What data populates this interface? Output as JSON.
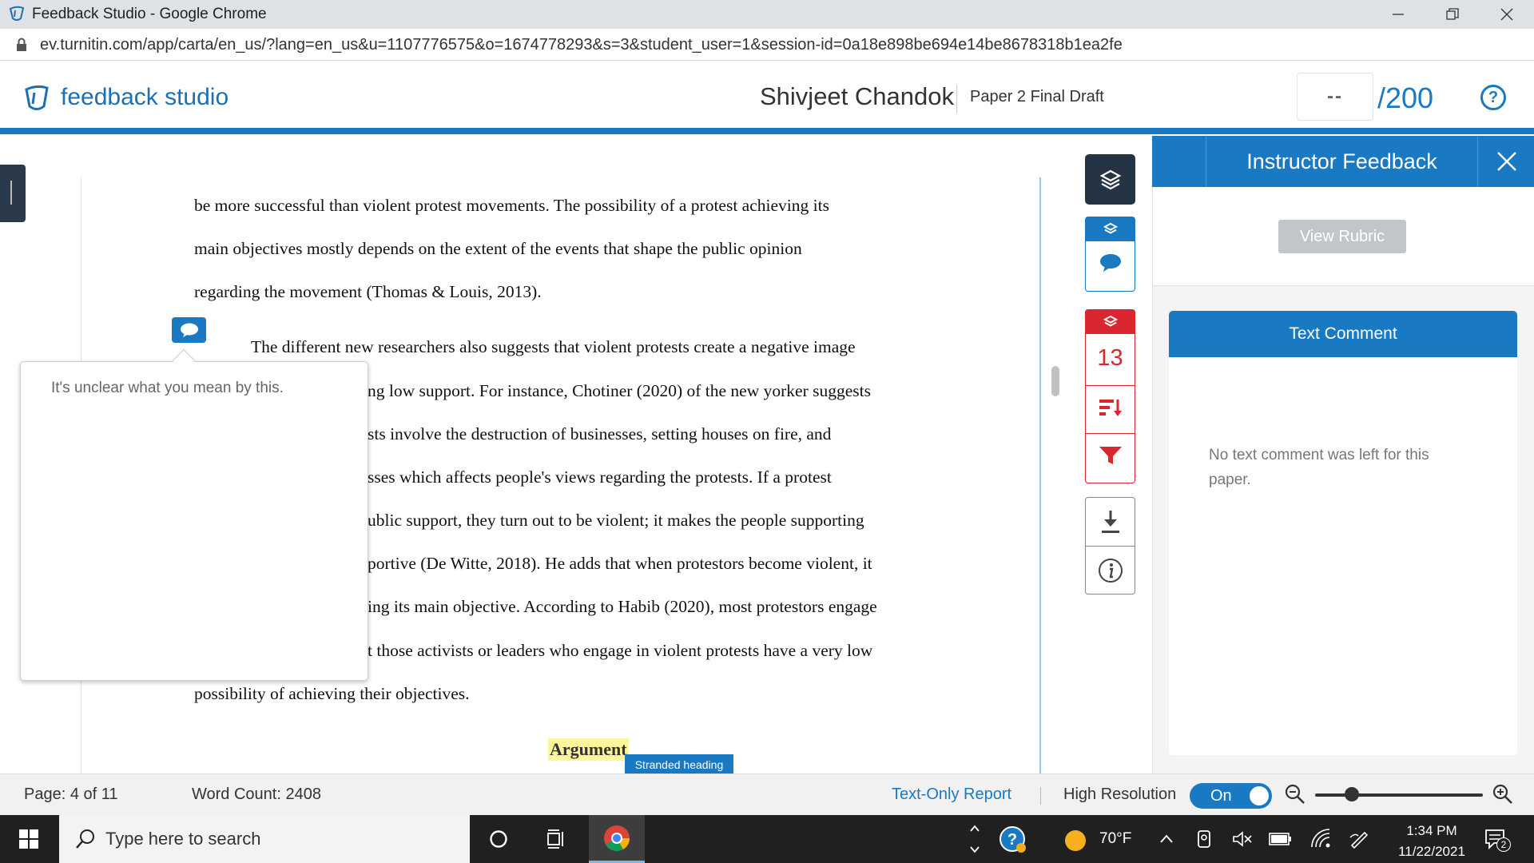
{
  "browser": {
    "window_title": "Feedback Studio - Google Chrome",
    "url": "ev.turnitin.com/app/carta/en_us/?lang=en_us&u=1107776575&o=1674778293&s=3&student_user=1&session-id=0a18e898be694e14be8678318b1ea2fe"
  },
  "header": {
    "brand": "feedback studio",
    "student_name": "Shivjeet Chandok",
    "paper_title": "Paper 2 Final Draft",
    "grade_value": "--",
    "grade_total": "/200",
    "help_label": "?"
  },
  "document": {
    "lines": [
      "be more successful than violent protest movements. The possibility of a protest achieving its",
      "main objectives mostly depends on the extent of the events that shape the public opinion",
      "regarding the movement (Thomas & Louis, 2013).",
      "The different new researchers also suggests that violent protests create a negative image",
      "ng low support. For instance, Chotiner (2020) of the new yorker suggests",
      "sts involve the destruction of businesses, setting houses on fire, and",
      "sses which affects people's views regarding the protests. If a protest",
      "ublic support, they turn out to be violent; it makes the people supporting",
      "portive (De Witte, 2018). He adds that when protestors become violent, it",
      "ing its main objective. According to Habib (2020), most protestors engage",
      "t those activists or leaders who engage in violent protests have a very low",
      "possibility of achieving their objectives."
    ],
    "comment_popup_text": "It's unclear what you mean by this.",
    "heading_text": "Argument",
    "stranded_label": "Stranded heading"
  },
  "tool_rail": {
    "similarity_score": "13"
  },
  "right_panel": {
    "title": "Instructor Feedback",
    "view_rubric_label": "View Rubric",
    "text_comment_title": "Text Comment",
    "text_comment_empty": "No text comment was left for this paper."
  },
  "status_bar": {
    "page": "Page: 4 of 11",
    "word_count": "Word Count: 2408",
    "text_only_report": "Text-Only Report",
    "high_resolution": "High Resolution",
    "toggle_state": "On",
    "zoom_level": 0.22
  },
  "taskbar": {
    "search_placeholder": "Type here to search",
    "temperature": "70°F",
    "time": "1:34 PM",
    "date": "11/22/2021",
    "notification_count": "2"
  },
  "colors": {
    "accent": "#1a79c3",
    "similarity": "#d9262f",
    "rail_dark": "#253445",
    "highlight": "#fff59d"
  }
}
